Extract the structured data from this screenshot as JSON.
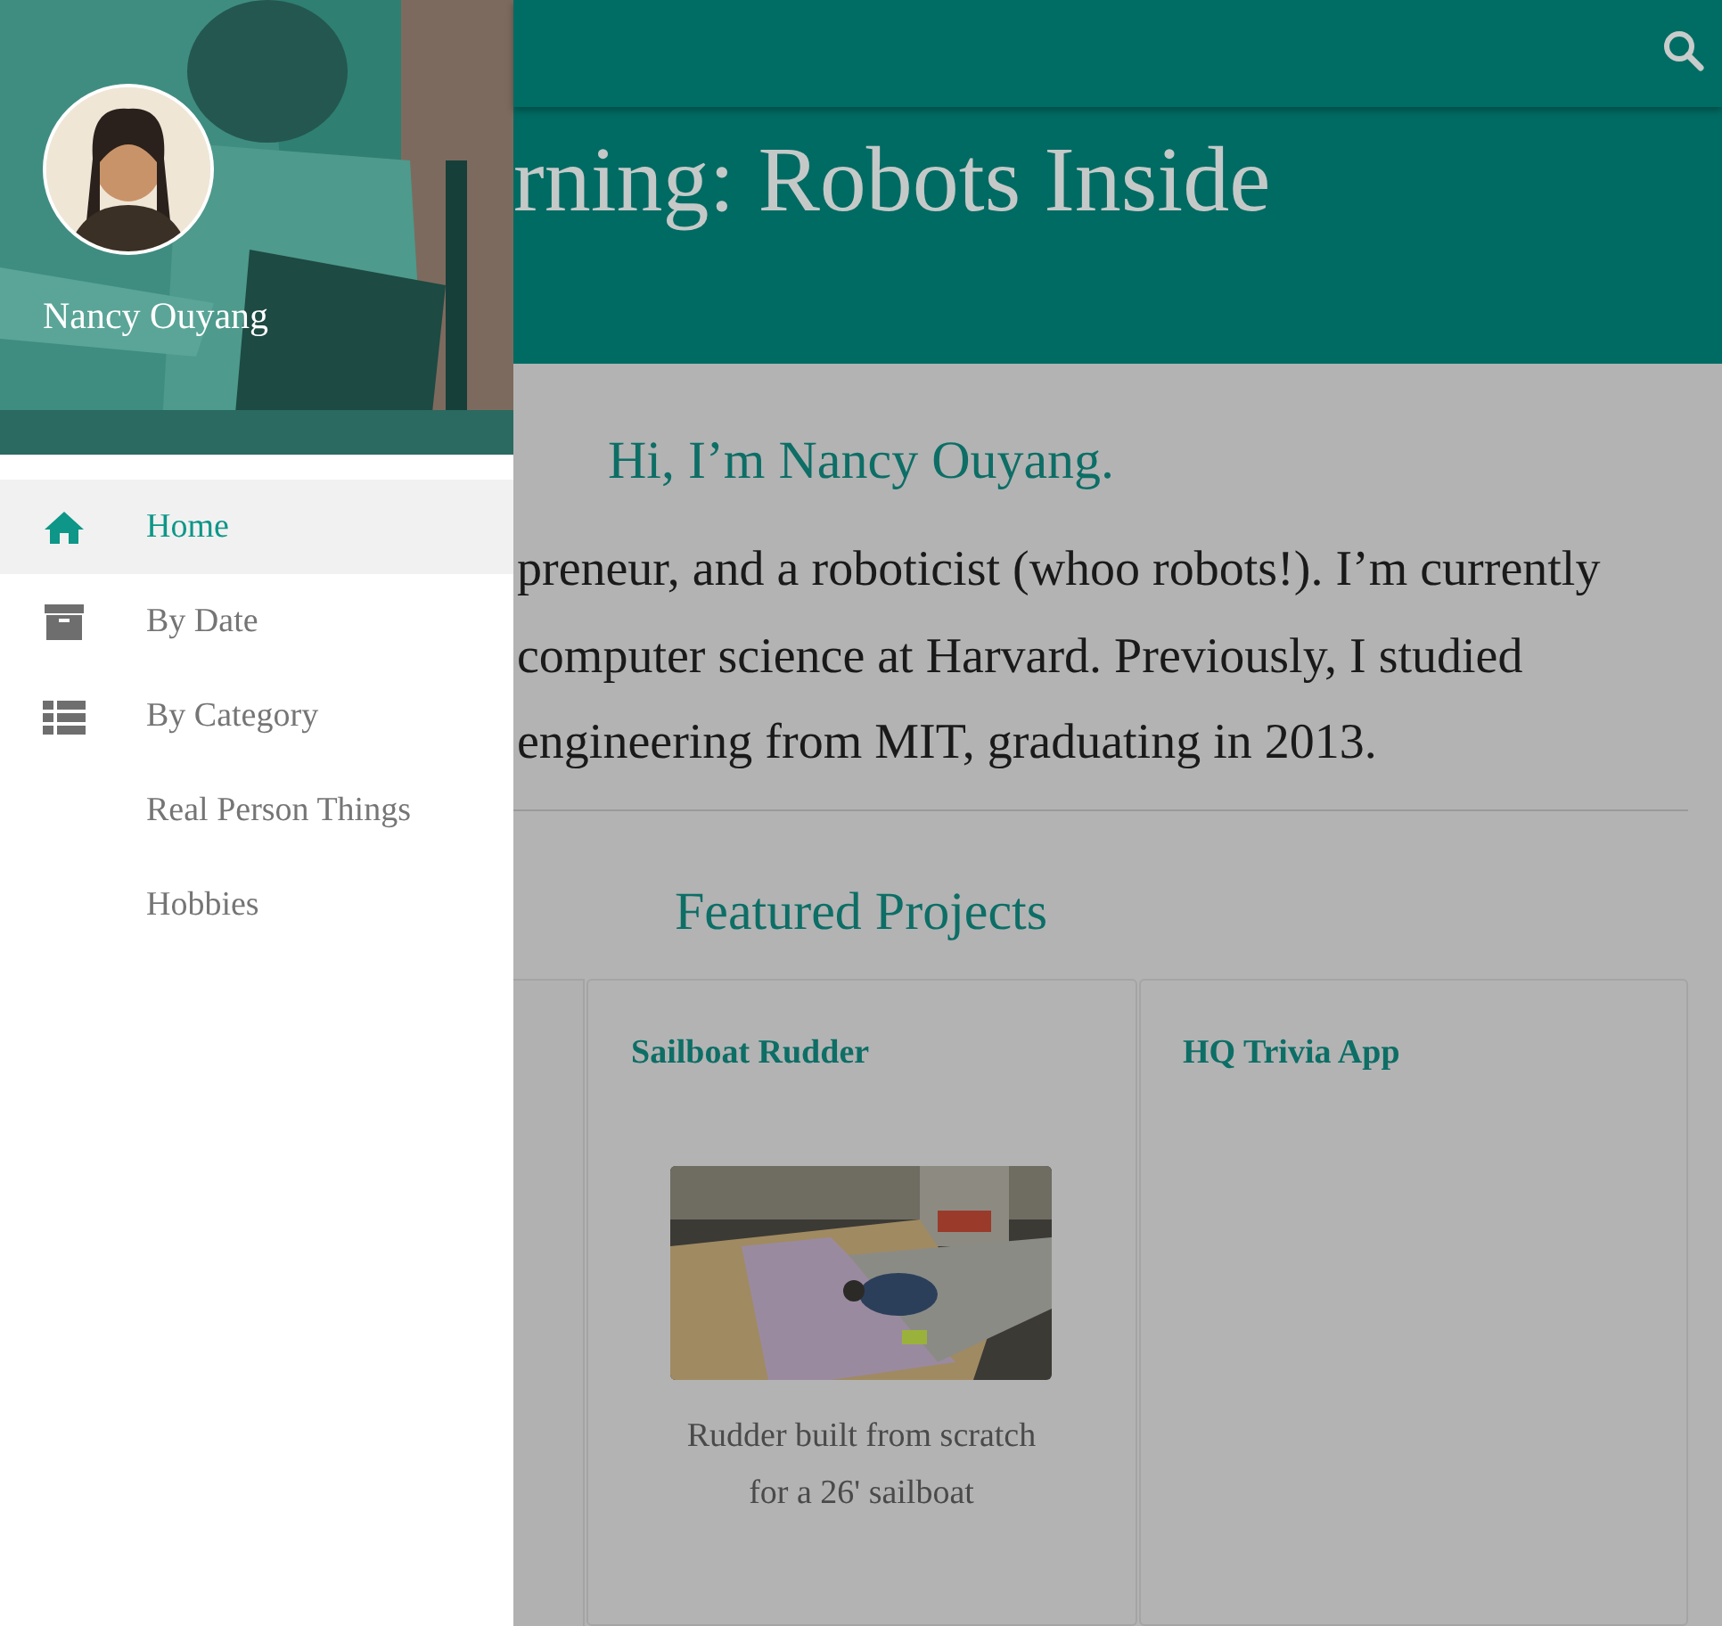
{
  "header": {
    "title": "rning: Robots Inside"
  },
  "drawer": {
    "profile": {
      "name": "Nancy Ouyang"
    },
    "items": [
      {
        "label": "Home",
        "kind": "home",
        "selected": true
      },
      {
        "label": "By Date",
        "kind": "archive",
        "selected": false
      },
      {
        "label": "By Category",
        "kind": "list",
        "selected": false
      },
      {
        "label": "Real Person Things",
        "kind": "plain",
        "selected": false
      },
      {
        "label": "Hobbies",
        "kind": "plain",
        "selected": false
      }
    ]
  },
  "intro": {
    "greeting": "Hi, I’m Nancy Ouyang.",
    "lines": [
      "preneur, and a roboticist (whoo robots!). I’m currently",
      "computer science at Harvard. Previously, I studied",
      "engineering from MIT, graduating in 2013."
    ]
  },
  "featured": {
    "heading": "Featured Projects",
    "cards": [
      {
        "title": "Sailboat Rudder",
        "caption": "Rudder built from scratch for a 26' sailboat"
      },
      {
        "title": "HQ Trivia App"
      }
    ]
  }
}
